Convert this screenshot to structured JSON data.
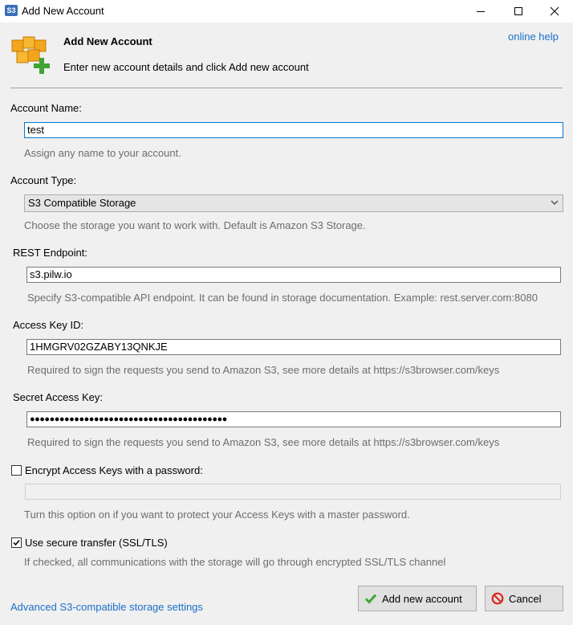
{
  "window": {
    "app_icon_text": "S3",
    "title": "Add New Account"
  },
  "header": {
    "title": "Add New Account",
    "subtitle": "Enter new account details and click Add new account",
    "help_link": "online help"
  },
  "form": {
    "account_name": {
      "label": "Account Name:",
      "value": "test",
      "hint": "Assign any name to your account."
    },
    "account_type": {
      "label": "Account Type:",
      "value": "S3 Compatible Storage",
      "hint": "Choose the storage you want to work with. Default is Amazon S3 Storage."
    },
    "rest_endpoint": {
      "label": "REST Endpoint:",
      "value": "s3.pilw.io",
      "hint": "Specify S3-compatible API endpoint. It can be found in storage documentation. Example: rest.server.com:8080"
    },
    "access_key_id": {
      "label": "Access Key ID:",
      "value": "1HMGRV02GZABY13QNKJE",
      "hint": "Required to sign the requests you send to Amazon S3, see more details at https://s3browser.com/keys"
    },
    "secret_access_key": {
      "label": "Secret Access Key:",
      "value": "●●●●●●●●●●●●●●●●●●●●●●●●●●●●●●●●●●●●●●●●",
      "hint": "Required to sign the requests you send to Amazon S3, see more details at https://s3browser.com/keys"
    },
    "encrypt_keys": {
      "label": "Encrypt Access Keys with a password:",
      "checked": false,
      "password_value": "",
      "hint": "Turn this option on if you want to protect your Access Keys with a master password."
    },
    "secure_transfer": {
      "label": "Use secure transfer (SSL/TLS)",
      "checked": true,
      "hint": "If checked, all communications with the storage will go through encrypted SSL/TLS channel"
    }
  },
  "footer": {
    "advanced_link": "Advanced S3-compatible storage settings",
    "add_button": "Add new account",
    "cancel_button": "Cancel"
  },
  "colors": {
    "link": "#1a6fc9",
    "hint_text": "#6d6d6d",
    "focus_border": "#0078d7",
    "add_icon": "#3fa535",
    "cancel_icon": "#d9281f",
    "logo_cube": "#f3a61d"
  },
  "icons": {
    "logo": "boxes-plus-icon",
    "add": "checkmark-icon",
    "cancel": "prohibited-icon"
  }
}
